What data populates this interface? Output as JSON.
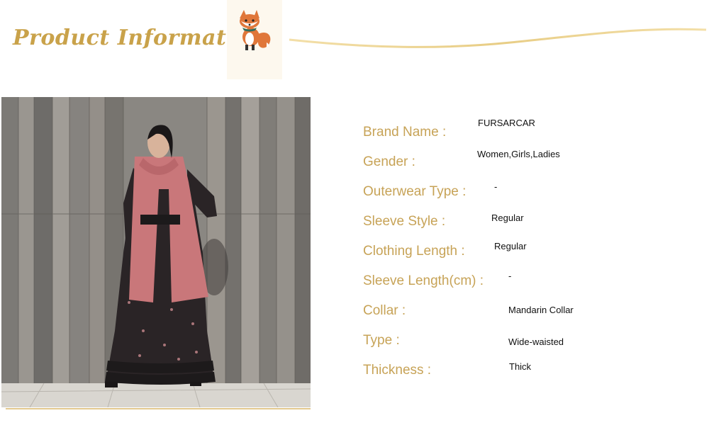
{
  "header": {
    "title": "Product Information",
    "accent_color": "#c9a24a",
    "icon": "fox-icon"
  },
  "photo": {
    "description_icon": "model-photo"
  },
  "specs": [
    {
      "label": "Brand Name :",
      "value": "FURSARCAR"
    },
    {
      "label": "Gender :",
      "value": "Women,Girls,Ladies"
    },
    {
      "label": "Outerwear Type :",
      "value": "-"
    },
    {
      "label": "Sleeve Style :",
      "value": "Regular"
    },
    {
      "label": "Clothing Length :",
      "value": "Regular"
    },
    {
      "label": "Sleeve Length(cm) :",
      "value": "-"
    },
    {
      "label": "Collar :",
      "value": "Mandarin Collar"
    },
    {
      "label": "Type :",
      "value": "Wide-waisted"
    },
    {
      "label": "Thickness :",
      "value": "Thick"
    }
  ]
}
